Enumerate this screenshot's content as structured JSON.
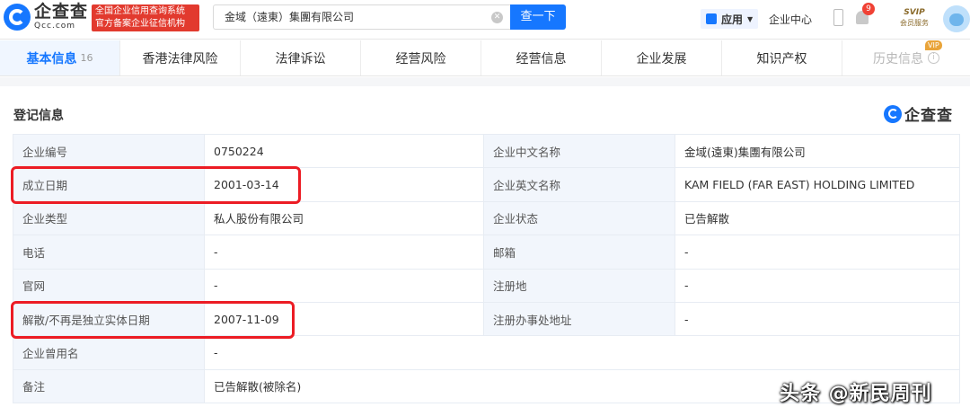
{
  "header": {
    "logo_text": "企查查",
    "logo_sub": "Qcc.com",
    "badge_line1": "全国企业信用查询系统",
    "badge_line2": "官方备案企业征信机构",
    "search_value": "金域（遠東）集團有限公司",
    "search_button": "查一下",
    "apps_label": "应用",
    "corp_center": "企业中心",
    "notification_count": "9",
    "svip_title": "SVIP",
    "svip_sub": "会员服务"
  },
  "tabs": [
    {
      "label": "基本信息",
      "count": "16"
    },
    {
      "label": "香港法律风险"
    },
    {
      "label": "法律诉讼"
    },
    {
      "label": "经营风险"
    },
    {
      "label": "经营信息"
    },
    {
      "label": "企业发展"
    },
    {
      "label": "知识产权"
    },
    {
      "label": "历史信息",
      "tag": "VIP"
    }
  ],
  "section": {
    "title": "登记信息",
    "watermark": "企查查"
  },
  "registration": {
    "rows": [
      {
        "l1": "企业编号",
        "v1": "0750224",
        "l2": "企业中文名称",
        "v2": "金域(遠東)集團有限公司"
      },
      {
        "l1": "成立日期",
        "v1": "2001-03-14",
        "l2": "企业英文名称",
        "v2": "KAM FIELD (FAR EAST) HOLDING LIMITED"
      },
      {
        "l1": "企业类型",
        "v1": "私人股份有限公司",
        "l2": "企业状态",
        "v2": "已告解散"
      },
      {
        "l1": "电话",
        "v1": "-",
        "l2": "邮箱",
        "v2": "-"
      },
      {
        "l1": "官网",
        "v1": "-",
        "l2": "注册地",
        "v2": "-"
      },
      {
        "l1": "解散/不再是独立实体日期",
        "v1": "2007-11-09",
        "l2": "注册办事处地址",
        "v2": "-"
      },
      {
        "l1": "企业曾用名",
        "v1": "-"
      },
      {
        "l1": "备注",
        "v1": "已告解散(被除名)"
      }
    ]
  },
  "caption": "头条 @新民周刊",
  "colors": {
    "accent": "#1677ff",
    "highlight": "#ec1c24",
    "label_bg": "#f2f6fc"
  }
}
